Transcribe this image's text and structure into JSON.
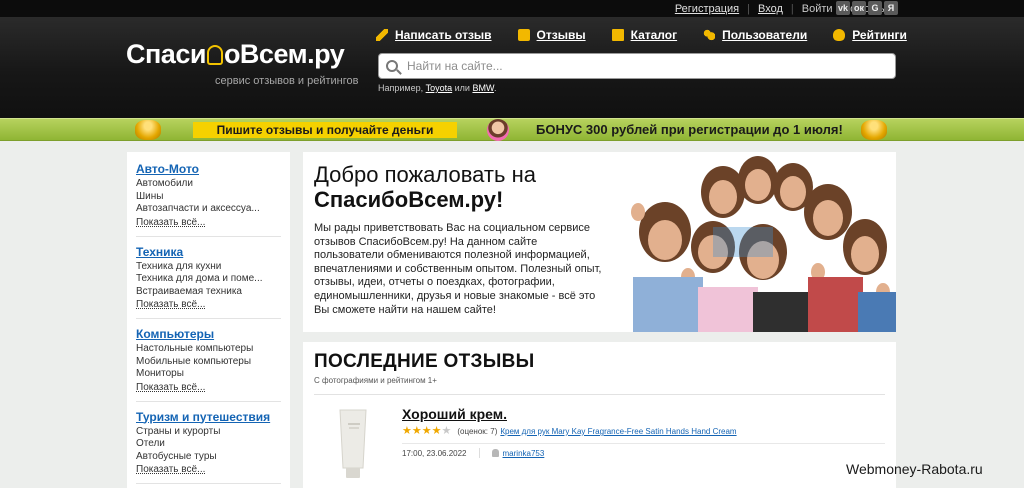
{
  "topbar": {
    "register": "Регистрация",
    "login": "Вход",
    "login_with": "Войти с помощью:",
    "social": [
      {
        "name": "vk-icon",
        "glyph": "vk"
      },
      {
        "name": "odnoklassniki-icon",
        "glyph": "ок"
      },
      {
        "name": "google-icon",
        "glyph": "G"
      },
      {
        "name": "yandex-icon",
        "glyph": "Я"
      }
    ]
  },
  "header": {
    "logo_part1": "Спаси",
    "logo_part2": "оВсем.ру",
    "tagline": "сервис отзывов и рейтингов",
    "nav": [
      {
        "label": "Написать отзыв",
        "icon": "pen-icon"
      },
      {
        "label": "Отзывы",
        "icon": "chat-icon"
      },
      {
        "label": "Каталог",
        "icon": "catalog-icon"
      },
      {
        "label": "Пользователи",
        "icon": "users-icon"
      },
      {
        "label": "Рейтинги",
        "icon": "bulb-icon"
      }
    ],
    "search_placeholder": "Найти на сайте...",
    "example_prefix": "Например, ",
    "example_link1": "Toyota",
    "example_mid": " или ",
    "example_link2": "BMW",
    "example_suffix": "."
  },
  "banner": {
    "left_text": "Пишите отзывы и получайте деньги",
    "right_text": "БОНУС 300 рублей при регистрации до 1 июля!"
  },
  "sidebar": {
    "categories": [
      {
        "title": "Авто-Мото",
        "items": [
          "Автомобили",
          "Шины",
          "Автозапчасти и аксессуа..."
        ],
        "more": "Показать всё..."
      },
      {
        "title": "Техника",
        "items": [
          "Техника для кухни",
          "Техника для дома и поме...",
          "Встраиваемая техника"
        ],
        "more": "Показать всё..."
      },
      {
        "title": "Компьютеры",
        "items": [
          "Настольные компьютеры",
          "Мобильные компьютеры",
          "Мониторы"
        ],
        "more": "Показать всё..."
      },
      {
        "title": "Туризм и путешествия",
        "items": [
          "Страны и курорты",
          "Отели",
          "Автобусные туры"
        ],
        "more": "Показать всё..."
      }
    ]
  },
  "welcome": {
    "title_line1": "Добро пожаловать на",
    "title_line2": "СпасибоВсем.ру!",
    "text": "Мы рады приветствовать Вас на социальном сервисе отзывов СпасибоВсем.ру! На данном сайте пользователи обмениваются полезной информацией, впечатлениями и собственным опытом. Полезный опыт, отзывы, идеи, отчеты о поездках, фотографии, единомышленники, друзья и новые знакомые - всё это Вы сможете найти на нашем сайте!"
  },
  "reviews": {
    "title": "ПОСЛЕДНИЕ ОТЗЫВЫ",
    "subtitle": "С фотографиями и рейтингом 1+",
    "item": {
      "title": "Хороший крем.",
      "rating": 4,
      "rating_max": 5,
      "score_text": "(оценок: 7)",
      "product": "Крем для рук Mary Kay Fragrance-Free Satin Hands Hand Cream",
      "date": "17:00, 23.06.2022",
      "user": "marinka753"
    }
  },
  "watermark": "Webmoney-Rabota.ru",
  "colors": {
    "link_blue": "#1464b4",
    "accent_yellow": "#f2b800",
    "banner_green": "#9cc13f",
    "header_dark": "#1a1a1a"
  }
}
